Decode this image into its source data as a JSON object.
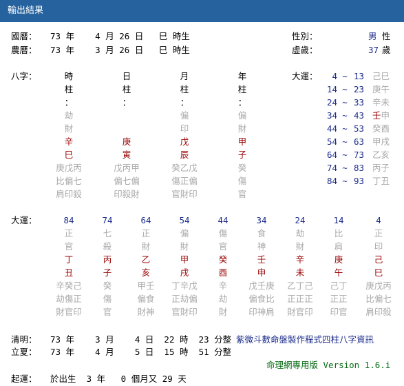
{
  "title": "輸出結果",
  "header": {
    "guoli_label": "國曆：",
    "guoli_value": "73 年    4 月 26 日   巳 時生",
    "nongli_label": "農曆：",
    "nongli_value": "73 年    3 月 26 日   巳 時生",
    "gender_label": "性別：",
    "gender_value": "男",
    "gender_suffix": "性",
    "age_label": "虛歲：",
    "age_value": "37",
    "age_suffix": "歲"
  },
  "bazi": {
    "label": "八字：",
    "pillars": [
      {
        "name1": "時",
        "name2": "柱",
        "colon": "：",
        "god": "劫",
        "god2": "財",
        "stem": "辛",
        "branch": "巳",
        "hidden1": "庚戊丙",
        "hidden2": "比偏七",
        "hidden3": "肩印殺"
      },
      {
        "name1": "日",
        "name2": "柱",
        "colon": "：",
        "god": "",
        "god2": "",
        "stem": "庚",
        "branch": "寅",
        "hidden1": "戊丙甲",
        "hidden2": "偏七偏",
        "hidden3": "印殺財"
      },
      {
        "name1": "月",
        "name2": "柱",
        "colon": "：",
        "god": "偏",
        "god2": "印",
        "stem": "戊",
        "branch": "辰",
        "hidden1": "癸乙戊",
        "hidden2": "傷正偏",
        "hidden3": "官財印"
      },
      {
        "name1": "年",
        "name2": "柱",
        "colon": "：",
        "god": "偏",
        "god2": "財",
        "stem": "甲",
        "branch": "子",
        "hidden1": "癸",
        "hidden2": "傷",
        "hidden3": "官"
      }
    ]
  },
  "dayun_right": {
    "label": "大運：",
    "rows": [
      {
        "from": "4",
        "tilde": "~",
        "to": "13",
        "gz": "己巳",
        "highlight": ""
      },
      {
        "from": "14",
        "tilde": "~",
        "to": "23",
        "gz": "庚午",
        "highlight": ""
      },
      {
        "from": "24",
        "tilde": "~",
        "to": "33",
        "gz": "辛未",
        "highlight": ""
      },
      {
        "from": "34",
        "tilde": "~",
        "to": "43",
        "gz": "壬申",
        "highlight": "壬"
      },
      {
        "from": "44",
        "tilde": "~",
        "to": "53",
        "gz": "癸酉",
        "highlight": ""
      },
      {
        "from": "54",
        "tilde": "~",
        "to": "63",
        "gz": "甲戌",
        "highlight": ""
      },
      {
        "from": "64",
        "tilde": "~",
        "to": "73",
        "gz": "乙亥",
        "highlight": ""
      },
      {
        "from": "74",
        "tilde": "~",
        "to": "83",
        "gz": "丙子",
        "highlight": ""
      },
      {
        "from": "84",
        "tilde": "~",
        "to": "93",
        "gz": "丁丑",
        "highlight": ""
      }
    ]
  },
  "dayun_table": {
    "label": "大運：",
    "columns": [
      {
        "age": "84",
        "g1": "正",
        "g2": "官",
        "stem": "丁",
        "branch": "丑",
        "h1": "辛癸己",
        "h2": "劫傷正",
        "h3": "財官印"
      },
      {
        "age": "74",
        "g1": "七",
        "g2": "殺",
        "stem": "丙",
        "branch": "子",
        "h1": "癸",
        "h2": "傷",
        "h3": "官"
      },
      {
        "age": "64",
        "g1": "正",
        "g2": "財",
        "stem": "乙",
        "branch": "亥",
        "h1": "甲壬",
        "h2": "偏食",
        "h3": "財神"
      },
      {
        "age": "54",
        "g1": "偏",
        "g2": "財",
        "stem": "甲",
        "branch": "戌",
        "h1": "丁辛戊",
        "h2": "正劫偏",
        "h3": "官財印"
      },
      {
        "age": "44",
        "g1": "傷",
        "g2": "官",
        "stem": "癸",
        "branch": "酉",
        "h1": "辛",
        "h2": "劫",
        "h3": "財"
      },
      {
        "age": "34",
        "g1": "食",
        "g2": "神",
        "stem": "壬",
        "branch": "申",
        "h1": "戊壬庚",
        "h2": "偏食比",
        "h3": "印神肩"
      },
      {
        "age": "24",
        "g1": "劫",
        "g2": "財",
        "stem": "辛",
        "branch": "未",
        "h1": "乙丁己",
        "h2": "正正正",
        "h3": "財官印"
      },
      {
        "age": "14",
        "g1": "比",
        "g2": "肩",
        "stem": "庚",
        "branch": "午",
        "h1": "己丁",
        "h2": "正正",
        "h3": "印官"
      },
      {
        "age": "4",
        "g1": "正",
        "g2": "印",
        "stem": "己",
        "branch": "巳",
        "h1": "庚戊丙",
        "h2": "比偏七",
        "h3": "肩印殺"
      }
    ]
  },
  "footer": {
    "qingming_label": "清明：",
    "qingming_value": "73 年    3 月    4 日  22 時  23 分整",
    "lixia_label": "立夏：",
    "lixia_value": "73 年    4 月    5 日  15 時  51 分整",
    "product_title": "紫微斗數命盤製作程式四柱八字資訊",
    "version_text": "命理網專用版 Version 1.6.i",
    "qiyun_label": "起運：",
    "qiyun_value": "於出生  3 年   0 個月又 29 天"
  },
  "colors": {
    "titlebar": "#26639e",
    "red": "#990000",
    "navy": "#1d2d8c",
    "gray": "#a9a9a9",
    "green": "#0a6c16"
  }
}
